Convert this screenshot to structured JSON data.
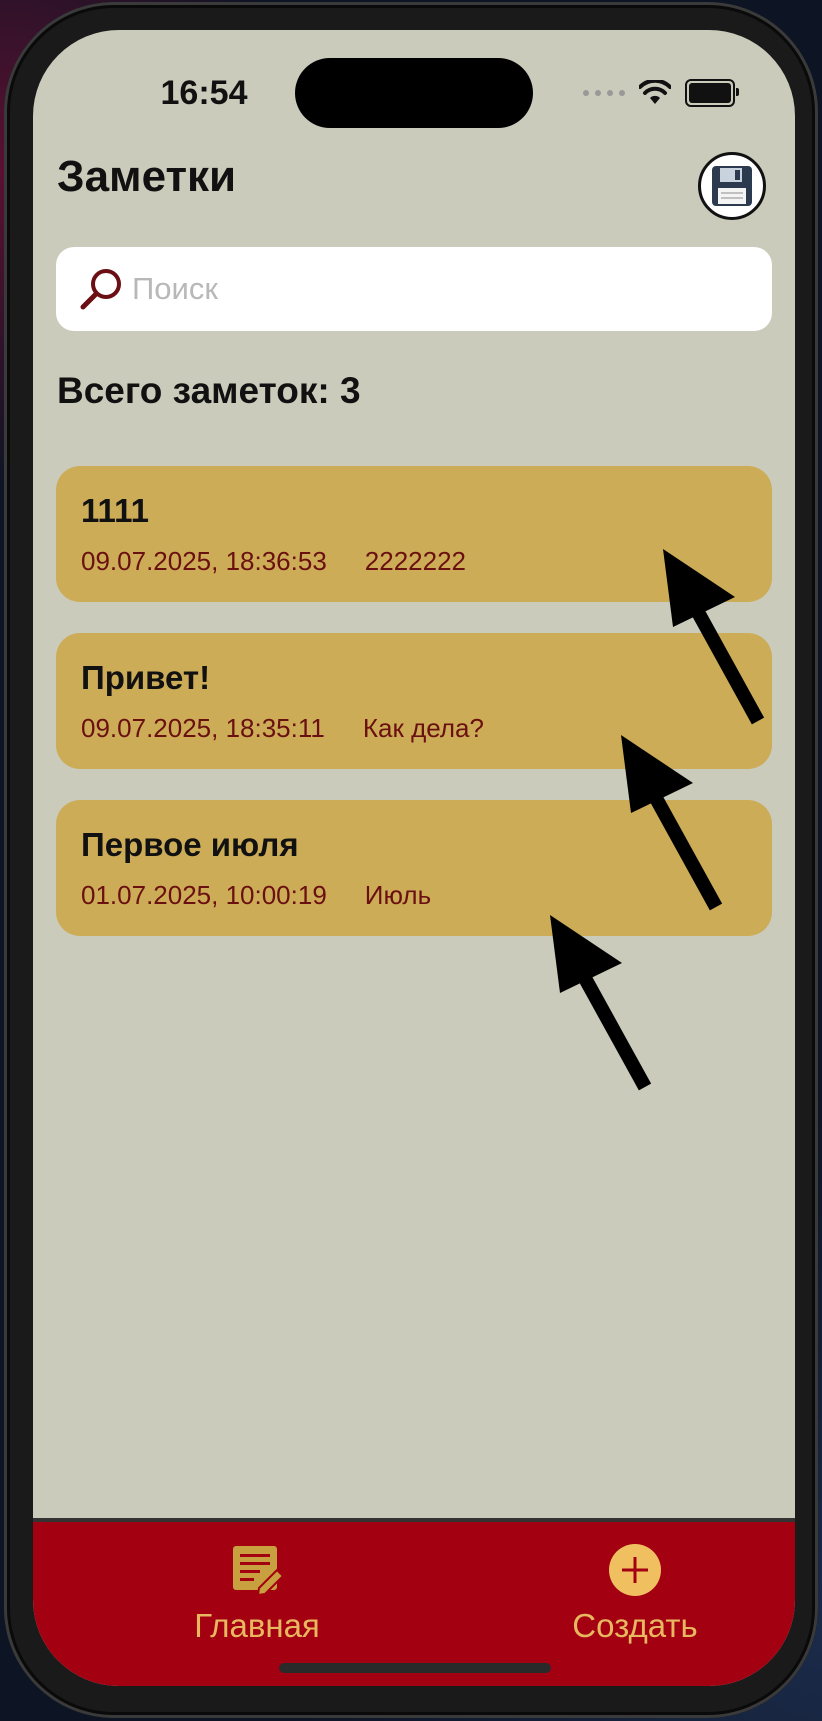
{
  "status": {
    "time": "16:54"
  },
  "header": {
    "title": "Заметки",
    "save_icon": "floppy-disk-icon"
  },
  "search": {
    "placeholder": "Поиск",
    "value": ""
  },
  "summary": {
    "count_text": "Всего заметок: 3"
  },
  "notes": [
    {
      "title": "1111",
      "date": "09.07.2025, 18:36:53",
      "preview": "2222222"
    },
    {
      "title": "Привет!",
      "date": "09.07.2025, 18:35:11",
      "preview": "Как дела?"
    },
    {
      "title": "Первое июля",
      "date": "01.07.2025, 10:00:19",
      "preview": "Июль"
    }
  ],
  "tabbar": {
    "home_label": "Главная",
    "create_label": "Создать",
    "home_icon": "note-edit-icon",
    "create_icon": "plus-circle-icon"
  },
  "colors": {
    "background": "#cacbbb",
    "card": "#cdac58",
    "tabbar": "#a30012",
    "tab_text": "#e8b860",
    "meta_text": "#6a1010"
  }
}
